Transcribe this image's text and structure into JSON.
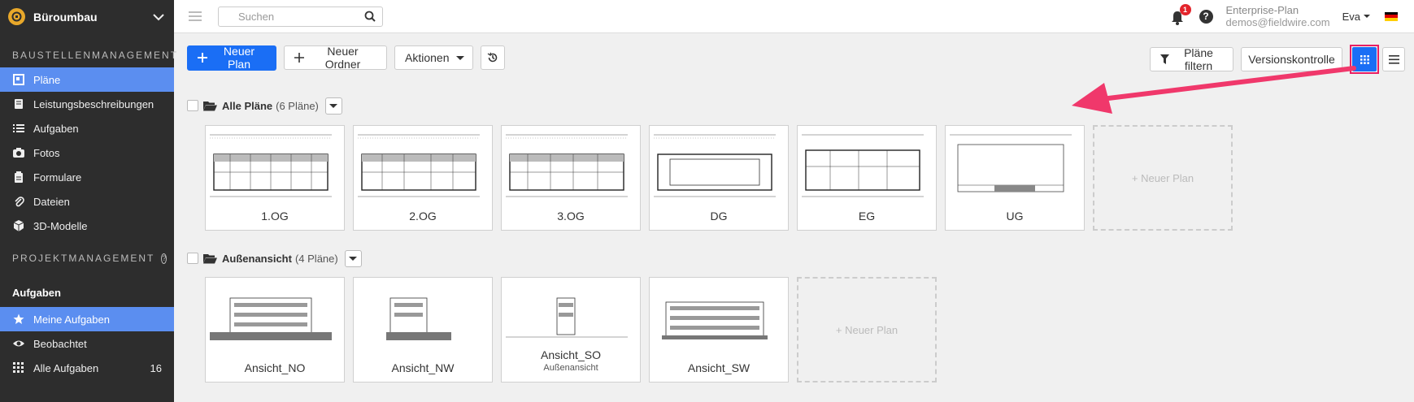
{
  "project": {
    "name": "Büroumbau"
  },
  "sidebar": {
    "section1": "BAUSTELLENMANAGEMENT",
    "items": [
      {
        "label": "Pläne",
        "icon": "plans-icon",
        "active": true
      },
      {
        "label": "Leistungsbeschreibungen",
        "icon": "notebook-icon"
      },
      {
        "label": "Aufgaben",
        "icon": "list-icon"
      },
      {
        "label": "Fotos",
        "icon": "camera-icon"
      },
      {
        "label": "Formulare",
        "icon": "clipboard-icon"
      },
      {
        "label": "Dateien",
        "icon": "paperclip-icon"
      },
      {
        "label": "3D-Modelle",
        "icon": "cube-icon"
      }
    ],
    "section2": "PROJEKTMANAGEMENT",
    "section3": "Aufgaben",
    "task_items": [
      {
        "label": "Meine Aufgaben",
        "icon": "star-icon",
        "active": true
      },
      {
        "label": "Beobachtet",
        "icon": "eye-icon"
      },
      {
        "label": "Alle Aufgaben",
        "icon": "grid-icon",
        "count": "16"
      }
    ]
  },
  "topbar": {
    "search_placeholder": "Suchen",
    "notifications_count": "1",
    "plan": "Enterprise-Plan",
    "email": "demos@fieldwire.com",
    "user": "Eva"
  },
  "toolbar": {
    "new_plan": "Neuer Plan",
    "new_folder": "Neuer Ordner",
    "actions": "Aktionen",
    "filter": "Pläne filtern",
    "version_control": "Versionskontrolle"
  },
  "folders": [
    {
      "name": "Alle Pläne",
      "count": "(6 Pläne)",
      "plans": [
        {
          "name": "1.OG",
          "sub": ""
        },
        {
          "name": "2.OG",
          "sub": ""
        },
        {
          "name": "3.OG",
          "sub": ""
        },
        {
          "name": "DG",
          "sub": ""
        },
        {
          "name": "EG",
          "sub": ""
        },
        {
          "name": "UG",
          "sub": ""
        }
      ],
      "new_label": "+ Neuer Plan"
    },
    {
      "name": "Außenansicht",
      "count": "(4 Pläne)",
      "plans": [
        {
          "name": "Ansicht_NO",
          "sub": ""
        },
        {
          "name": "Ansicht_NW",
          "sub": ""
        },
        {
          "name": "Ansicht_SO",
          "sub": "Außenansicht"
        },
        {
          "name": "Ansicht_SW",
          "sub": ""
        }
      ],
      "new_label": "+ Neuer Plan"
    }
  ],
  "colors": {
    "accent": "#1a6ef5",
    "sidebar": "#2d2d2d",
    "active": "#5b8ef0",
    "highlight": "#e91e63"
  }
}
